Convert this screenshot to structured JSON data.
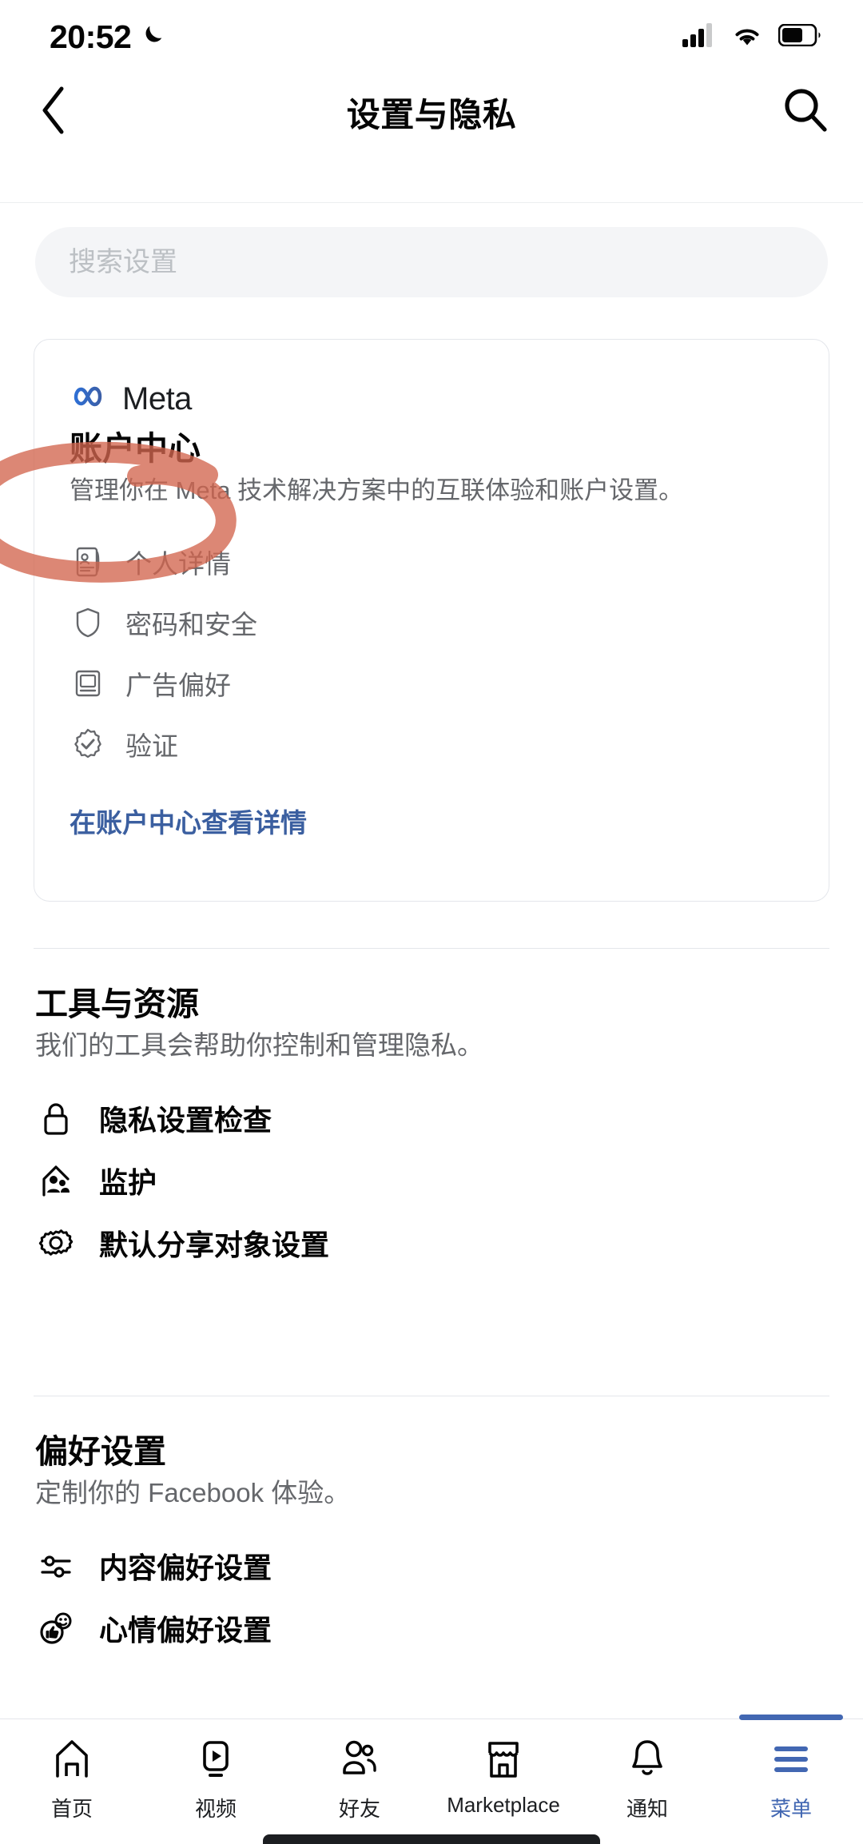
{
  "status_bar": {
    "time": "20:52",
    "moon_icon": "crescent-moon-icon",
    "signal_icon": "cellular-signal-icon",
    "wifi_icon": "wifi-icon",
    "battery_icon": "battery-icon"
  },
  "header": {
    "back_icon": "chevron-left-icon",
    "title": "设置与隐私",
    "search_icon": "magnifier-icon"
  },
  "search": {
    "placeholder": "搜索设置",
    "value": ""
  },
  "meta_card": {
    "brand_logo": "meta-infinity-logo",
    "brand_name": "Meta",
    "title": "账户中心",
    "description": "管理你在 Meta 技术解决方案中的互联体验和账户设置。",
    "items": [
      {
        "label": "个人详情",
        "icon": "id-card-icon"
      },
      {
        "label": "密码和安全",
        "icon": "shield-icon"
      },
      {
        "label": "广告偏好",
        "icon": "monitor-icon"
      },
      {
        "label": "验证",
        "icon": "verified-badge-icon"
      }
    ],
    "link_label": "在账户中心查看详情",
    "link_color": "#3b5fa0"
  },
  "tools_section": {
    "title": "工具与资源",
    "subtitle": "我们的工具会帮助你控制和管理隐私。",
    "rows": [
      {
        "label": "隐私设置检查",
        "icon": "lock-icon"
      },
      {
        "label": "监护",
        "icon": "supervision-house-icon"
      },
      {
        "label": "默认分享对象设置",
        "icon": "gear-icon"
      }
    ]
  },
  "preferences_section": {
    "title": "偏好设置",
    "subtitle": "定制你的 Facebook 体验。",
    "rows": [
      {
        "label": "内容偏好设置",
        "icon": "sliders-icon"
      },
      {
        "label": "心情偏好设置",
        "icon": "reactions-icon"
      }
    ]
  },
  "annotation": {
    "shape": "hand-drawn-oval",
    "color": "#d4705c",
    "targets": "个人详情"
  },
  "bottom_nav": {
    "active_color": "#4267b2",
    "items": [
      {
        "label": "首页",
        "icon": "home-icon",
        "active": false
      },
      {
        "label": "视频",
        "icon": "video-play-icon",
        "active": false
      },
      {
        "label": "好友",
        "icon": "friends-icon",
        "active": false
      },
      {
        "label": "Marketplace",
        "icon": "storefront-icon",
        "active": false
      },
      {
        "label": "通知",
        "icon": "bell-icon",
        "active": false
      },
      {
        "label": "菜单",
        "icon": "hamburger-menu-icon",
        "active": true
      }
    ]
  }
}
